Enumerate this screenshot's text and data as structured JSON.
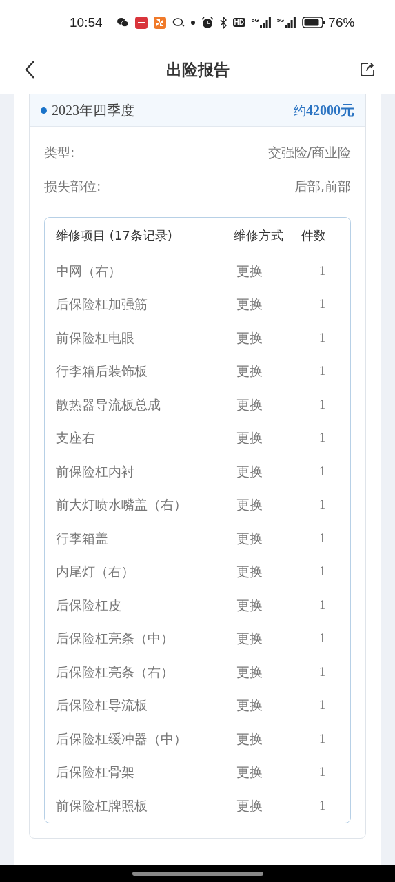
{
  "status_bar": {
    "time": "10:54",
    "hd": "HD",
    "signals": [
      "5G",
      "5G"
    ],
    "battery": "76%"
  },
  "header": {
    "title": "出险报告"
  },
  "report": {
    "period": "2023年四季度",
    "amount_prefix": "约",
    "amount": "42000元",
    "info": [
      {
        "label": "类型:",
        "value": "交强险/商业险"
      },
      {
        "label": "损失部位:",
        "value": "后部,前部"
      }
    ],
    "table": {
      "columns": [
        "维修项目 (17条记录)",
        "维修方式",
        "件数"
      ],
      "rows": [
        [
          "中网（右）",
          "更换",
          "1"
        ],
        [
          "后保险杠加强筋",
          "更换",
          "1"
        ],
        [
          "前保险杠电眼",
          "更换",
          "1"
        ],
        [
          "行李箱后装饰板",
          "更换",
          "1"
        ],
        [
          "散热器导流板总成",
          "更换",
          "1"
        ],
        [
          "支座右",
          "更换",
          "1"
        ],
        [
          "前保险杠内衬",
          "更换",
          "1"
        ],
        [
          "前大灯喷水嘴盖（右）",
          "更换",
          "1"
        ],
        [
          "行李箱盖",
          "更换",
          "1"
        ],
        [
          "内尾灯（右）",
          "更换",
          "1"
        ],
        [
          "后保险杠皮",
          "更换",
          "1"
        ],
        [
          "后保险杠亮条（中）",
          "更换",
          "1"
        ],
        [
          "后保险杠亮条（右）",
          "更换",
          "1"
        ],
        [
          "后保险杠导流板",
          "更换",
          "1"
        ],
        [
          "后保险杠缓冲器（中）",
          "更换",
          "1"
        ],
        [
          "后保险杠骨架",
          "更换",
          "1"
        ],
        [
          "前保险杠牌照板",
          "更换",
          "1"
        ]
      ]
    }
  }
}
